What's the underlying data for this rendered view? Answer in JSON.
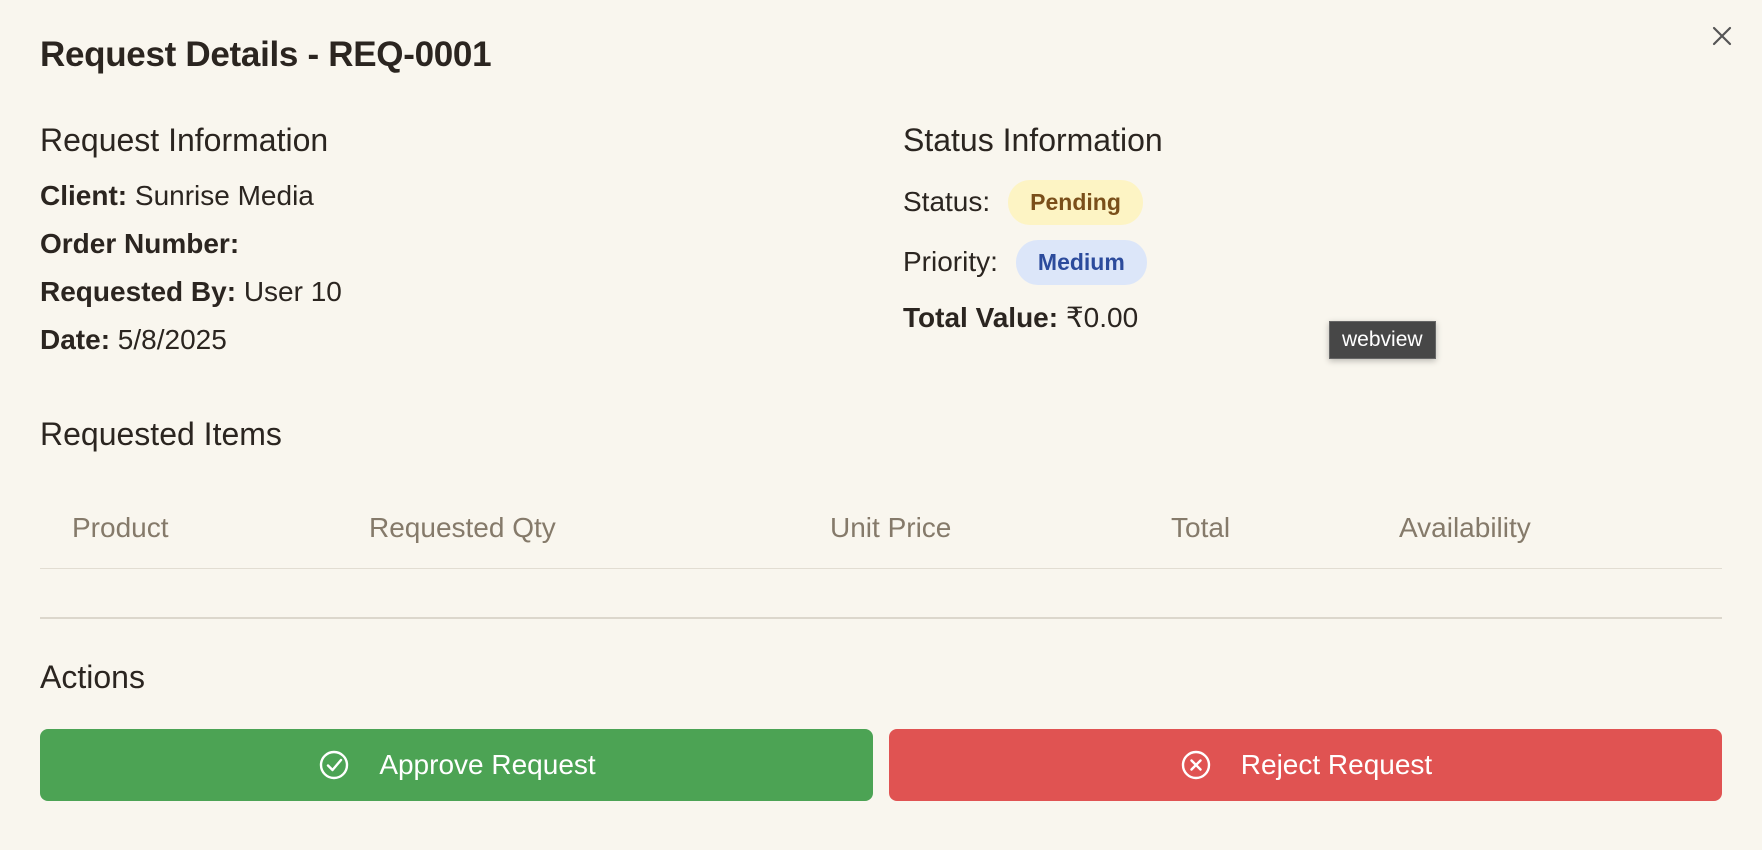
{
  "dialog": {
    "title": "Request Details - REQ-0001",
    "close_icon": "close-icon"
  },
  "request_info": {
    "heading": "Request Information",
    "client_label": "Client:",
    "client_value": "Sunrise Media",
    "order_label": "Order Number:",
    "order_value": "",
    "requested_by_label": "Requested By:",
    "requested_by_value": "User 10",
    "date_label": "Date:",
    "date_value": "5/8/2025"
  },
  "status_info": {
    "heading": "Status Information",
    "status_label": "Status:",
    "status_value": "Pending",
    "priority_label": "Priority:",
    "priority_value": "Medium",
    "total_label": "Total Value:",
    "total_value": "₹0.00"
  },
  "tooltip": {
    "text": "webview"
  },
  "items": {
    "heading": "Requested Items",
    "columns": [
      "Product",
      "Requested Qty",
      "Unit Price",
      "Total",
      "Availability"
    ],
    "rows": []
  },
  "actions": {
    "heading": "Actions",
    "approve_label": "Approve Request",
    "approve_icon": "check-circle-icon",
    "reject_label": "Reject Request",
    "reject_icon": "x-circle-icon"
  },
  "colors": {
    "background": "#f9f6ee",
    "approve": "#4ca354",
    "reject": "#e05352",
    "pending_badge_bg": "#fdf4c4",
    "medium_badge_bg": "#dce6f9"
  }
}
